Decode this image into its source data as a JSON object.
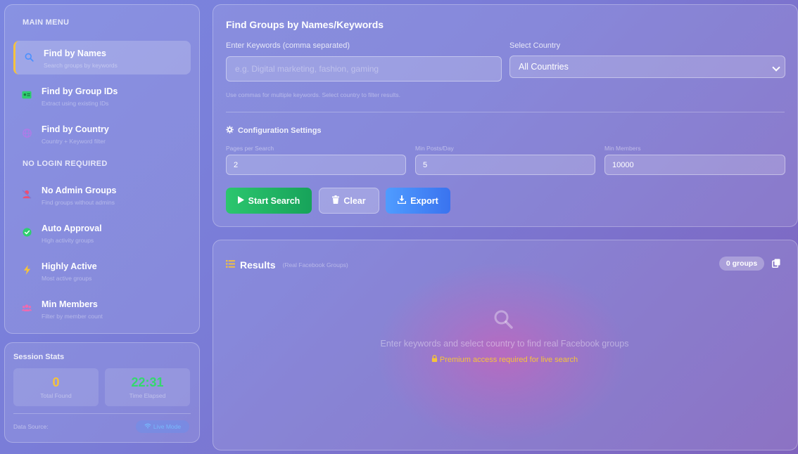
{
  "sidebar": {
    "main_menu_title": "MAIN MENU",
    "no_login_title": "NO LOGIN REQUIRED",
    "items": [
      {
        "label": "Find by Names",
        "sub": "Search groups by keywords",
        "icon": "search-icon",
        "color": "#4a90ff"
      },
      {
        "label": "Find by Group IDs",
        "sub": "Extract using existing IDs",
        "icon": "id-card-icon",
        "color": "#2fce70"
      },
      {
        "label": "Find by Country",
        "sub": "Country + Keyword filter",
        "icon": "globe-icon",
        "color": "#b07ae8"
      },
      {
        "label": "No Admin Groups",
        "sub": "Find groups without admins",
        "icon": "user-slash-icon",
        "color": "#f04d70"
      },
      {
        "label": "Auto Approval",
        "sub": "High activity groups",
        "icon": "check-circle-icon",
        "color": "#2fce70"
      },
      {
        "label": "Highly Active",
        "sub": "Most active groups",
        "icon": "bolt-icon",
        "color": "#f6c33a"
      },
      {
        "label": "Min Members",
        "sub": "Filter by member count",
        "icon": "users-icon",
        "color": "#f06ab0"
      }
    ]
  },
  "stats": {
    "title": "Session Stats",
    "total_found_value": "0",
    "total_found_label": "Total Found",
    "time_value": "22:31",
    "time_label": "Time Elapsed",
    "data_source_label": "Data Source:",
    "data_source_value": "Live Mode",
    "colors": {
      "found": "#f6c33a",
      "time": "#34d86e"
    }
  },
  "search": {
    "title": "Find Groups by Names/Keywords",
    "keywords_label": "Enter Keywords (comma separated)",
    "keywords_placeholder": "e.g. Digital marketing, fashion, gaming",
    "country_label": "Select Country",
    "country_value": "All Countries",
    "hint": "Use commas for multiple keywords. Select country to filter results.",
    "config_title": "Configuration Settings",
    "pages_label": "Pages per Search",
    "pages_value": "2",
    "posts_label": "Min Posts/Day",
    "posts_value": "5",
    "members_label": "Min Members",
    "members_value": "10000",
    "start_label": "Start Search",
    "clear_label": "Clear",
    "export_label": "Export"
  },
  "results": {
    "title": "Results",
    "subtitle": "(Real Facebook Groups)",
    "count": "0 groups",
    "empty_text": "Enter keywords and select country to find real Facebook groups",
    "premium_text": "Premium access required for live search"
  }
}
